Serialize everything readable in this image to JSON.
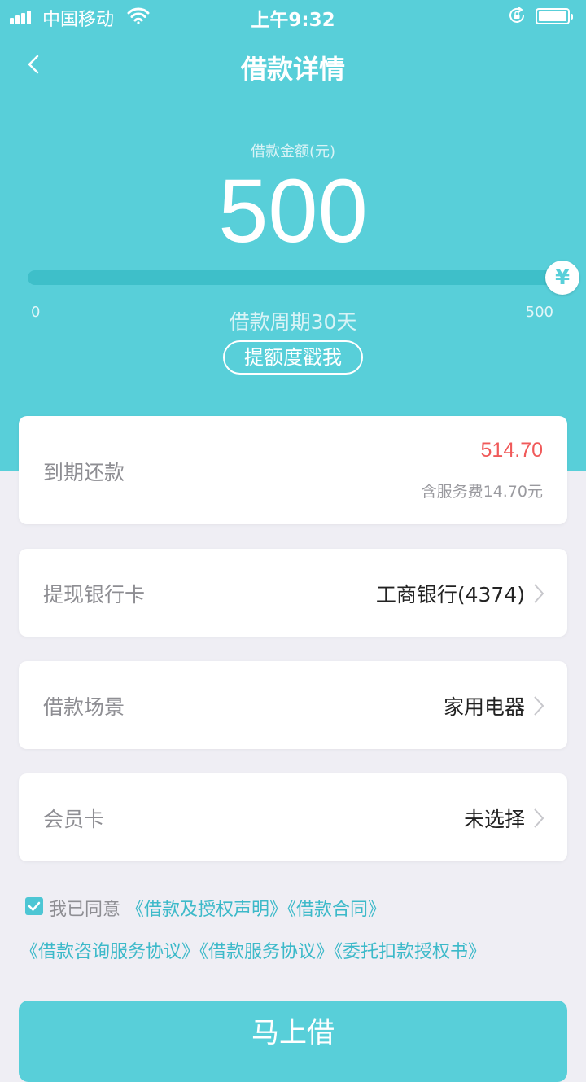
{
  "status_bar": {
    "carrier": "中国移动",
    "time": "上午9:32",
    "icons": [
      "signal-icon",
      "wifi-icon",
      "orientation-lock-icon",
      "battery-icon"
    ]
  },
  "nav": {
    "title": "借款详情",
    "back_icon": "chevron-left-icon"
  },
  "loan": {
    "amount_label": "借款金额(元)",
    "amount": "500",
    "slider_min": "0",
    "slider_max": "500",
    "slider_value_fraction": 1.0,
    "slider_handle_symbol": "¥",
    "period": "借款周期30天",
    "raise_limit_button": "提额度戳我"
  },
  "due": {
    "label": "到期还款",
    "amount": "514.70",
    "fee_note": "含服务费14.70元"
  },
  "rows": [
    {
      "label": "提现银行卡",
      "value": "工商银行(4374)"
    },
    {
      "label": "借款场景",
      "value": "家用电器"
    },
    {
      "label": "会员卡",
      "value": "未选择"
    }
  ],
  "agreement": {
    "checked": true,
    "prefix": "我已同意",
    "links_line1": [
      "《借款及授权声明》",
      "《借款合同》"
    ],
    "links_line2": [
      "《借款咨询服务协议》",
      "《借款服务协议》",
      "《委托扣款授权书》"
    ]
  },
  "submit_button": "马上借",
  "colors": {
    "primary": "#58cfd9",
    "due_amount": "#f05a5a",
    "link": "#3cb9c9",
    "background": "#efeef4"
  }
}
